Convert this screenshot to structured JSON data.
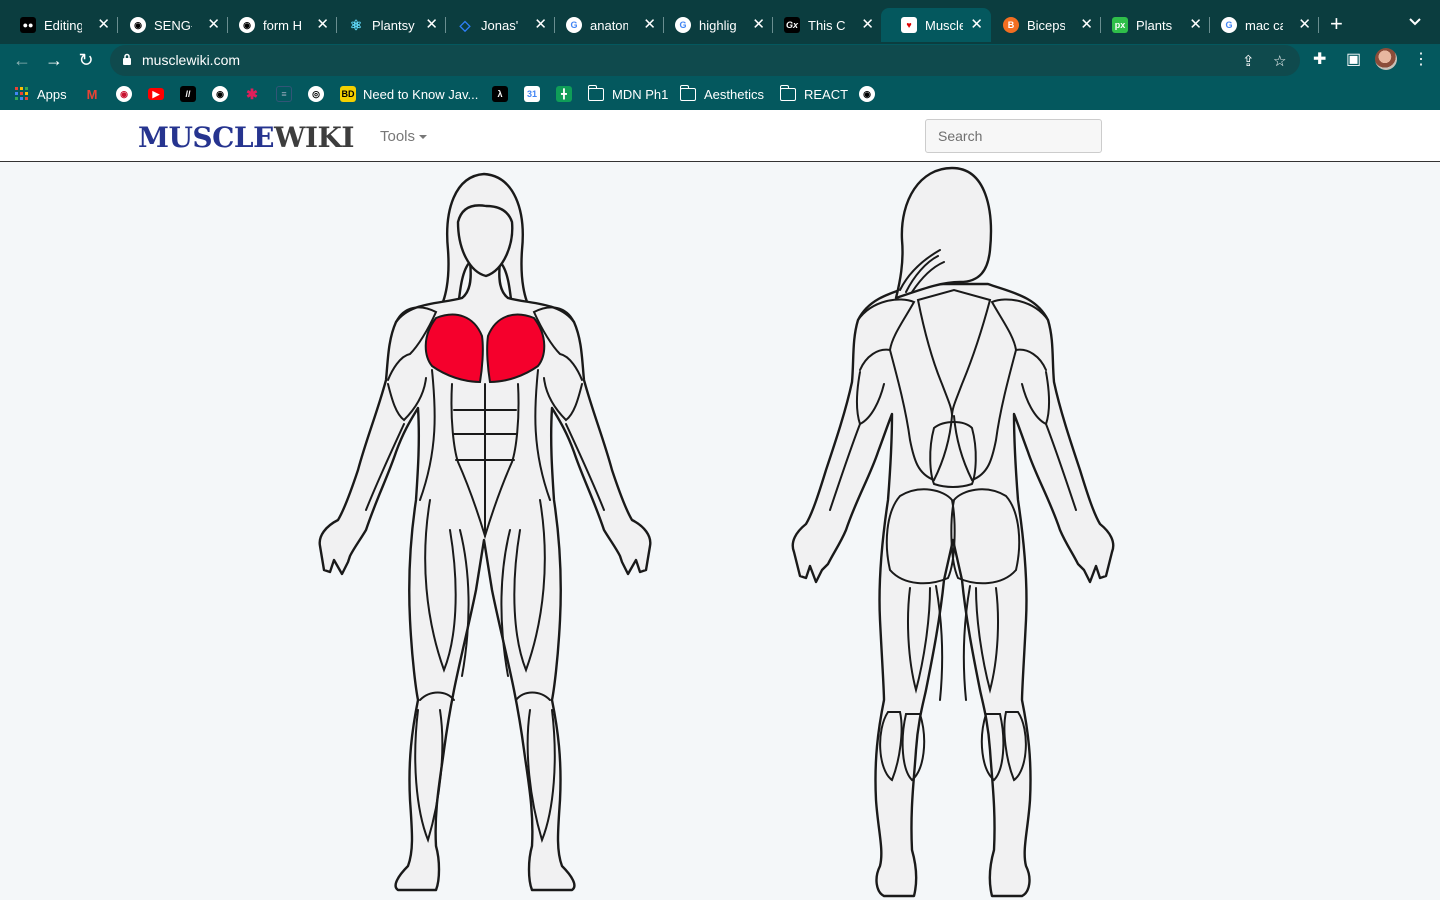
{
  "browser": {
    "tabs": [
      {
        "title": "Editing (",
        "favicon": "medium",
        "color": "#000000"
      },
      {
        "title": "SENG-E",
        "favicon": "github",
        "color": "#000000"
      },
      {
        "title": "form HT",
        "favicon": "github",
        "color": "#000000"
      },
      {
        "title": "Plantsy",
        "favicon": "react",
        "color": "#61dafb"
      },
      {
        "title": "Jonas' F",
        "favicon": "diamond",
        "color": "#2d7ff9"
      },
      {
        "title": "anatom",
        "favicon": "google",
        "color": "#ffffff"
      },
      {
        "title": "highligh",
        "favicon": "google",
        "color": "#ffffff"
      },
      {
        "title": "This Co",
        "favicon": "gx",
        "color": "#000000"
      },
      {
        "title": "MuscleV",
        "favicon": "musclewiki",
        "color": "#ffffff",
        "active": true
      },
      {
        "title": "Biceps I",
        "favicon": "orange-circle",
        "color": "#f36e21"
      },
      {
        "title": "Plants L",
        "favicon": "px",
        "color": "#2fbf4a"
      },
      {
        "title": "mac cap",
        "favicon": "google",
        "color": "#ffffff"
      }
    ],
    "url": "musclewiki.com",
    "bookmarks": [
      {
        "label": "Apps",
        "icon": "apps-grid-icon"
      },
      {
        "label": "",
        "icon": "gmail-icon"
      },
      {
        "label": "",
        "icon": "target-icon"
      },
      {
        "label": "",
        "icon": "youtube-icon"
      },
      {
        "label": "",
        "icon": "slash-icon"
      },
      {
        "label": "",
        "icon": "github-icon"
      },
      {
        "label": "",
        "icon": "slack-icon"
      },
      {
        "label": "",
        "icon": "doc-icon"
      },
      {
        "label": "",
        "icon": "circle-icon"
      },
      {
        "label": "Need to Know Jav...",
        "icon": "bd-icon"
      },
      {
        "label": "",
        "icon": "lambda-icon"
      },
      {
        "label": "",
        "icon": "calendar-icon"
      },
      {
        "label": "",
        "icon": "sheets-icon"
      },
      {
        "label": "MDN Ph1",
        "icon": "folder-icon"
      },
      {
        "label": "Aesthetics",
        "icon": "folder-icon"
      },
      {
        "label": "REACT",
        "icon": "folder-icon"
      },
      {
        "label": "",
        "icon": "github-icon"
      }
    ]
  },
  "site": {
    "logo_part1": "MUSCLE",
    "logo_part2": "WIKI",
    "tools_label": "Tools",
    "search_placeholder": "Search",
    "colors": {
      "highlight": "#f5002c",
      "brand_blue": "#26348f",
      "brand_grey": "#3d3d3d"
    },
    "selected_muscle": "chest"
  }
}
